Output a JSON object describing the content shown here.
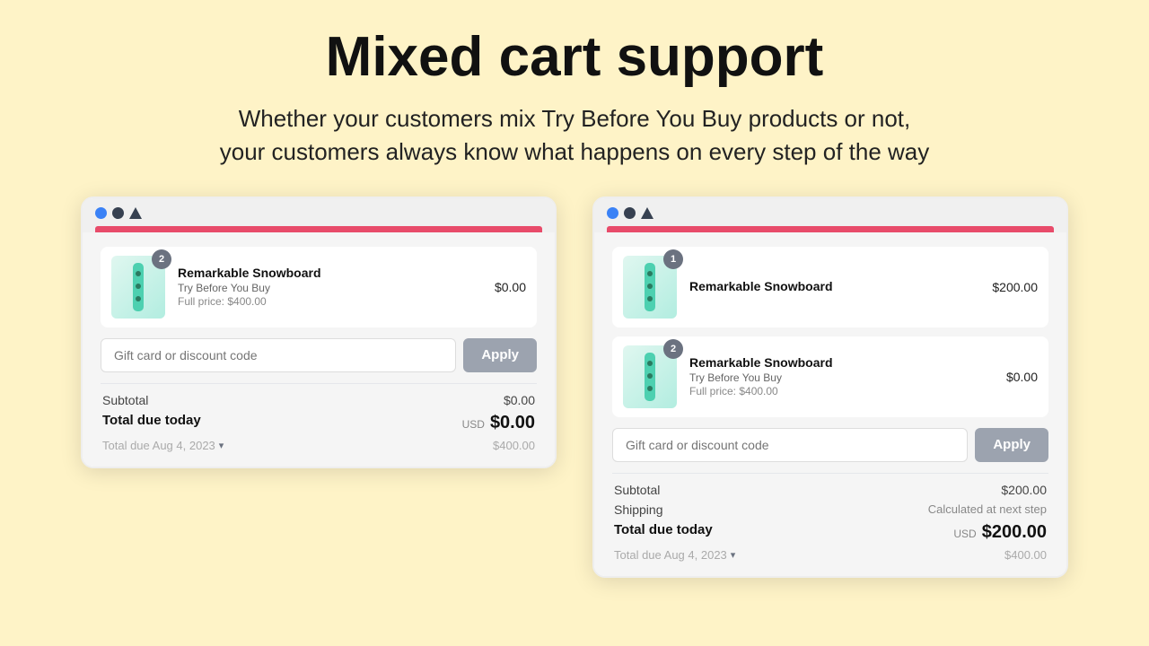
{
  "page": {
    "title": "Mixed cart support",
    "subtitle": "Whether your customers mix Try Before You Buy products or not,\nyour customers always know what happens on every step of the way"
  },
  "cart_left": {
    "item": {
      "badge": "2",
      "name": "Remarkable Snowboard",
      "tag": "Try Before You Buy",
      "fullprice": "Full price: $400.00",
      "price": "$0.00"
    },
    "discount_placeholder": "Gift card or discount code",
    "apply_label": "Apply",
    "subtotal_label": "Subtotal",
    "subtotal_value": "$0.00",
    "total_label": "Total due today",
    "total_usd": "USD",
    "total_value": "$0.00",
    "future_label": "Total due Aug 4, 2023",
    "future_value": "$400.00"
  },
  "cart_right": {
    "item1": {
      "badge": "1",
      "name": "Remarkable Snowboard",
      "price": "$200.00"
    },
    "item2": {
      "badge": "2",
      "name": "Remarkable Snowboard",
      "tag": "Try Before You Buy",
      "fullprice": "Full price: $400.00",
      "price": "$0.00"
    },
    "discount_placeholder": "Gift card or discount code",
    "apply_label": "Apply",
    "subtotal_label": "Subtotal",
    "subtotal_value": "$200.00",
    "shipping_label": "Shipping",
    "shipping_value": "Calculated at next step",
    "total_label": "Total due today",
    "total_usd": "USD",
    "total_value": "$200.00",
    "future_label": "Total due Aug 4, 2023",
    "future_value": "$400.00"
  }
}
